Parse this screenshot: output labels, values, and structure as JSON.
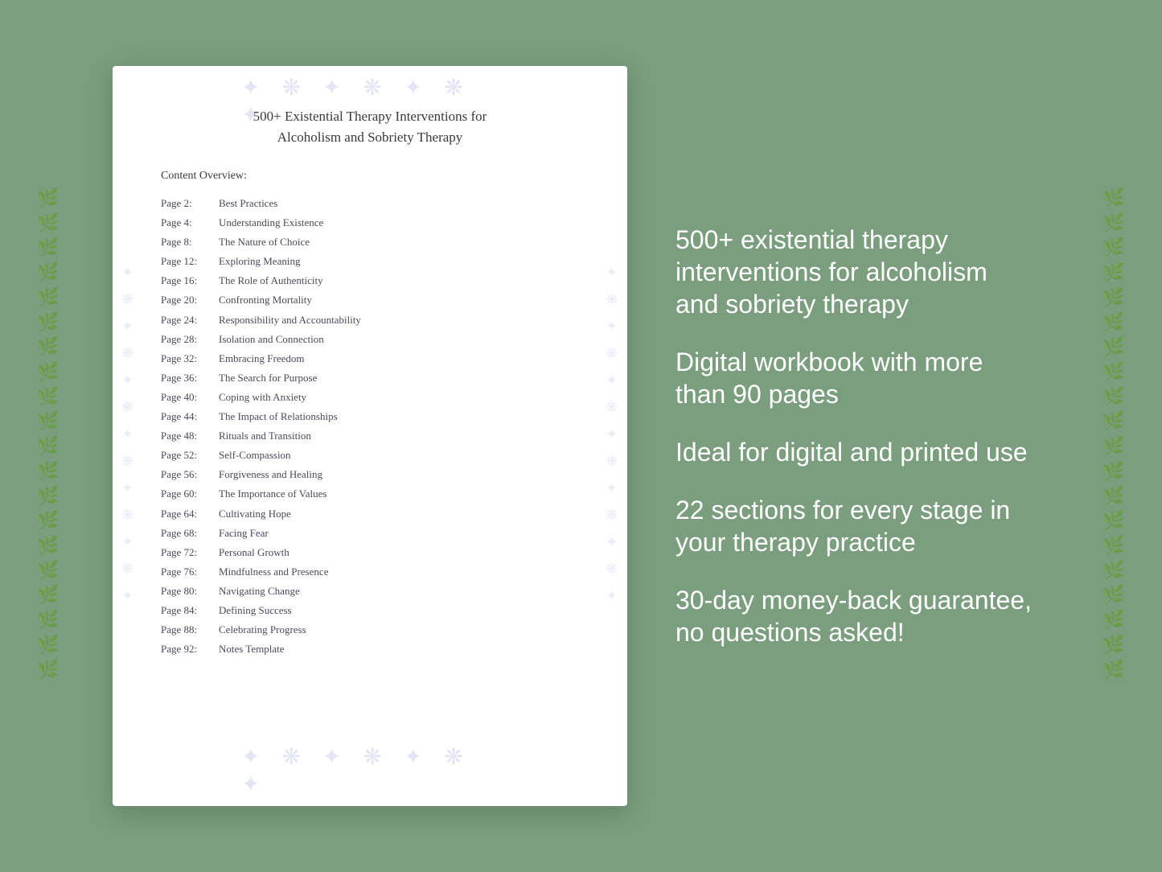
{
  "document": {
    "title_line1": "500+ Existential Therapy Interventions for",
    "title_line2": "Alcoholism and Sobriety Therapy",
    "section_label": "Content Overview:",
    "toc": [
      {
        "page": "Page  2:",
        "title": "Best Practices"
      },
      {
        "page": "Page  4:",
        "title": "Understanding Existence"
      },
      {
        "page": "Page  8:",
        "title": "The Nature of Choice"
      },
      {
        "page": "Page 12:",
        "title": "Exploring Meaning"
      },
      {
        "page": "Page 16:",
        "title": "The Role of Authenticity"
      },
      {
        "page": "Page 20:",
        "title": "Confronting Mortality"
      },
      {
        "page": "Page 24:",
        "title": "Responsibility and Accountability"
      },
      {
        "page": "Page 28:",
        "title": "Isolation and Connection"
      },
      {
        "page": "Page 32:",
        "title": "Embracing Freedom"
      },
      {
        "page": "Page 36:",
        "title": "The Search for Purpose"
      },
      {
        "page": "Page 40:",
        "title": "Coping with Anxiety"
      },
      {
        "page": "Page 44:",
        "title": "The Impact of Relationships"
      },
      {
        "page": "Page 48:",
        "title": "Rituals and Transition"
      },
      {
        "page": "Page 52:",
        "title": "Self-Compassion"
      },
      {
        "page": "Page 56:",
        "title": "Forgiveness and Healing"
      },
      {
        "page": "Page 60:",
        "title": "The Importance of Values"
      },
      {
        "page": "Page 64:",
        "title": "Cultivating Hope"
      },
      {
        "page": "Page 68:",
        "title": "Facing Fear"
      },
      {
        "page": "Page 72:",
        "title": "Personal Growth"
      },
      {
        "page": "Page 76:",
        "title": "Mindfulness and Presence"
      },
      {
        "page": "Page 80:",
        "title": "Navigating Change"
      },
      {
        "page": "Page 84:",
        "title": "Defining Success"
      },
      {
        "page": "Page 88:",
        "title": "Celebrating Progress"
      },
      {
        "page": "Page 92:",
        "title": "Notes Template"
      }
    ]
  },
  "info_blocks": [
    "500+ existential therapy interventions for alcoholism and sobriety therapy",
    "Digital workbook with more than 90 pages",
    "Ideal for digital and printed use",
    "22 sections for every stage in your therapy practice",
    "30-day money-back guarantee, no questions asked!"
  ]
}
